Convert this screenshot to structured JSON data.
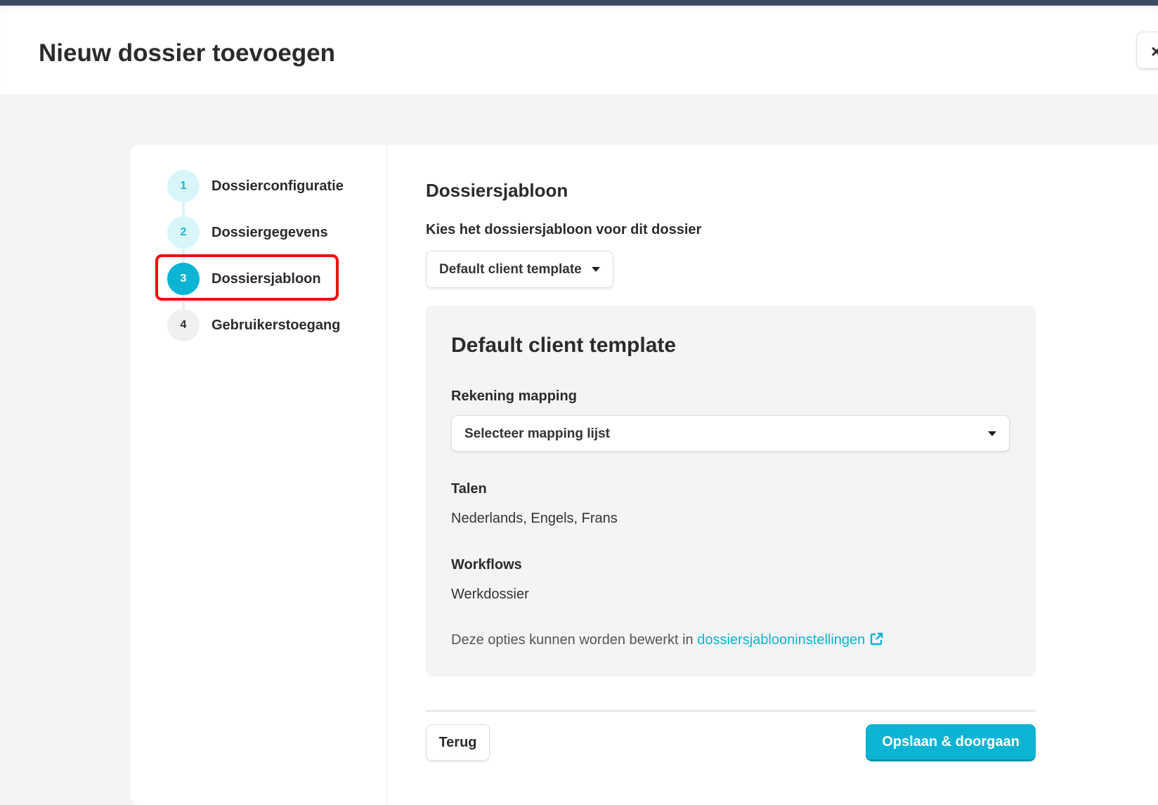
{
  "header": {
    "title": "Nieuw dossier toevoegen",
    "close_label": "×"
  },
  "steps": [
    {
      "number": "1",
      "label": "Dossierconfiguratie",
      "state": "done"
    },
    {
      "number": "2",
      "label": "Dossiergegevens",
      "state": "done"
    },
    {
      "number": "3",
      "label": "Dossiersjabloon",
      "state": "active"
    },
    {
      "number": "4",
      "label": "Gebruikerstoegang",
      "state": "todo"
    }
  ],
  "main": {
    "heading": "Dossiersjabloon",
    "template_label": "Kies het dossiersjabloon voor dit dossier",
    "template_value": "Default client template",
    "panel": {
      "heading": "Default client template",
      "mapping_label": "Rekening mapping",
      "mapping_placeholder": "Selecteer mapping lijst",
      "languages_label": "Talen",
      "languages_value": "Nederlands, Engels, Frans",
      "workflows_label": "Workflows",
      "workflows_value": "Werkdossier",
      "note_text": "Deze opties kunnen worden bewerkt in",
      "note_link": "dossiersjablooninstellingen"
    },
    "back_label": "Terug",
    "save_label": "Opslaan & doorgaan"
  },
  "colors": {
    "accent": "#0bb4d3",
    "highlight": "#f20d0d"
  }
}
